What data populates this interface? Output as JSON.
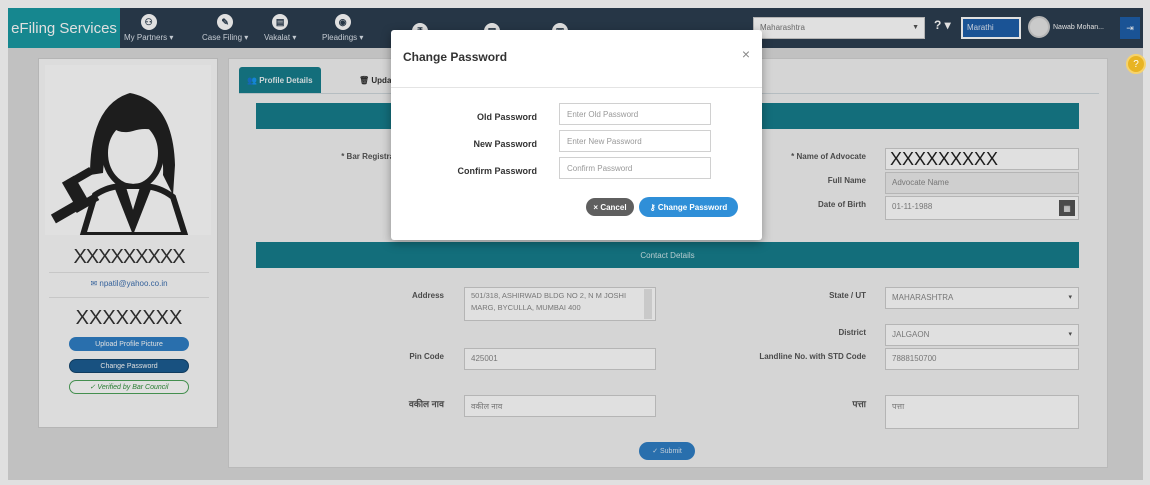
{
  "navbar": {
    "brand": "eFiling Services",
    "items": [
      {
        "label": "My Partners ▾",
        "icon": "handshake-icon",
        "glyph": "⚇"
      },
      {
        "label": "Case Filing ▾",
        "icon": "pencil-icon",
        "glyph": "✎"
      },
      {
        "label": "Vakalat ▾",
        "icon": "document-icon",
        "glyph": "▤"
      },
      {
        "label": "Pleadings ▾",
        "icon": "globe-icon",
        "glyph": "◉"
      },
      {
        "label": "",
        "icon": "rupee-icon",
        "glyph": "₹"
      },
      {
        "label": "",
        "icon": "file-icon",
        "glyph": "▤"
      },
      {
        "label": "",
        "icon": "briefcase-icon",
        "glyph": "▣"
      }
    ],
    "state_select": "Maharashtra",
    "help": "? ▾",
    "language": "Marathi",
    "user_name": "Nawab Mohan...",
    "logout_glyph": "⇥"
  },
  "profile_card": {
    "name": "XXXXXXXXX",
    "email": "npatil@yahoo.co.in",
    "id_number": "XXXXXXXX",
    "upload_btn": "Upload Profile Picture",
    "change_pw_btn": "Change Password",
    "verified_badge": "✓ Verified by Bar Council"
  },
  "main": {
    "tabs": [
      {
        "label": "Profile Details"
      },
      {
        "label": "Upda"
      }
    ],
    "sections": {
      "contact_title": "Contact Details"
    },
    "fields": {
      "bar_registration_label": "* Bar Registrati",
      "name_of_advocate_label": "* Name of Advocate",
      "name_of_advocate_value": "XXXXXXXXX",
      "full_name_label": "Full Name",
      "full_name_placeholder": "Advocate Name",
      "dob_label": "Date of Birth",
      "dob_value": "01-11-1988",
      "address_label": "Address",
      "address_value": "501/318, ASHIRWAD BLDG NO 2, N M JOSHI MARG, BYCULLA, MUMBAI 400",
      "state_label": "State / UT",
      "state_value": "MAHARASHTRA",
      "district_label": "District",
      "district_value": "JALGAON",
      "pincode_label": "Pin Code",
      "pincode_value": "425001",
      "landline_label": "Landline No. with STD Code",
      "landline_value": "7888150700",
      "advocate_name_marathi_label": "वकील नाव",
      "advocate_name_marathi_placeholder": "वकील नाव",
      "address_marathi_label": "पत्ता",
      "address_marathi_placeholder": "पत्ता"
    },
    "submit_label": "Submit"
  },
  "modal": {
    "title": "Change Password",
    "close_glyph": "×",
    "old_label": "Old Password",
    "old_placeholder": "Enter Old Password",
    "new_label": "New Password",
    "new_placeholder": "Enter New Password",
    "confirm_label": "Confirm Password",
    "confirm_placeholder": "Confirm Password",
    "cancel_label": "× Cancel",
    "submit_label": "Change Password"
  },
  "colors": {
    "navbar": "#2c3e50",
    "brand": "#1a9aa3",
    "teal": "#167e8c",
    "primary": "#2f8fd8"
  }
}
